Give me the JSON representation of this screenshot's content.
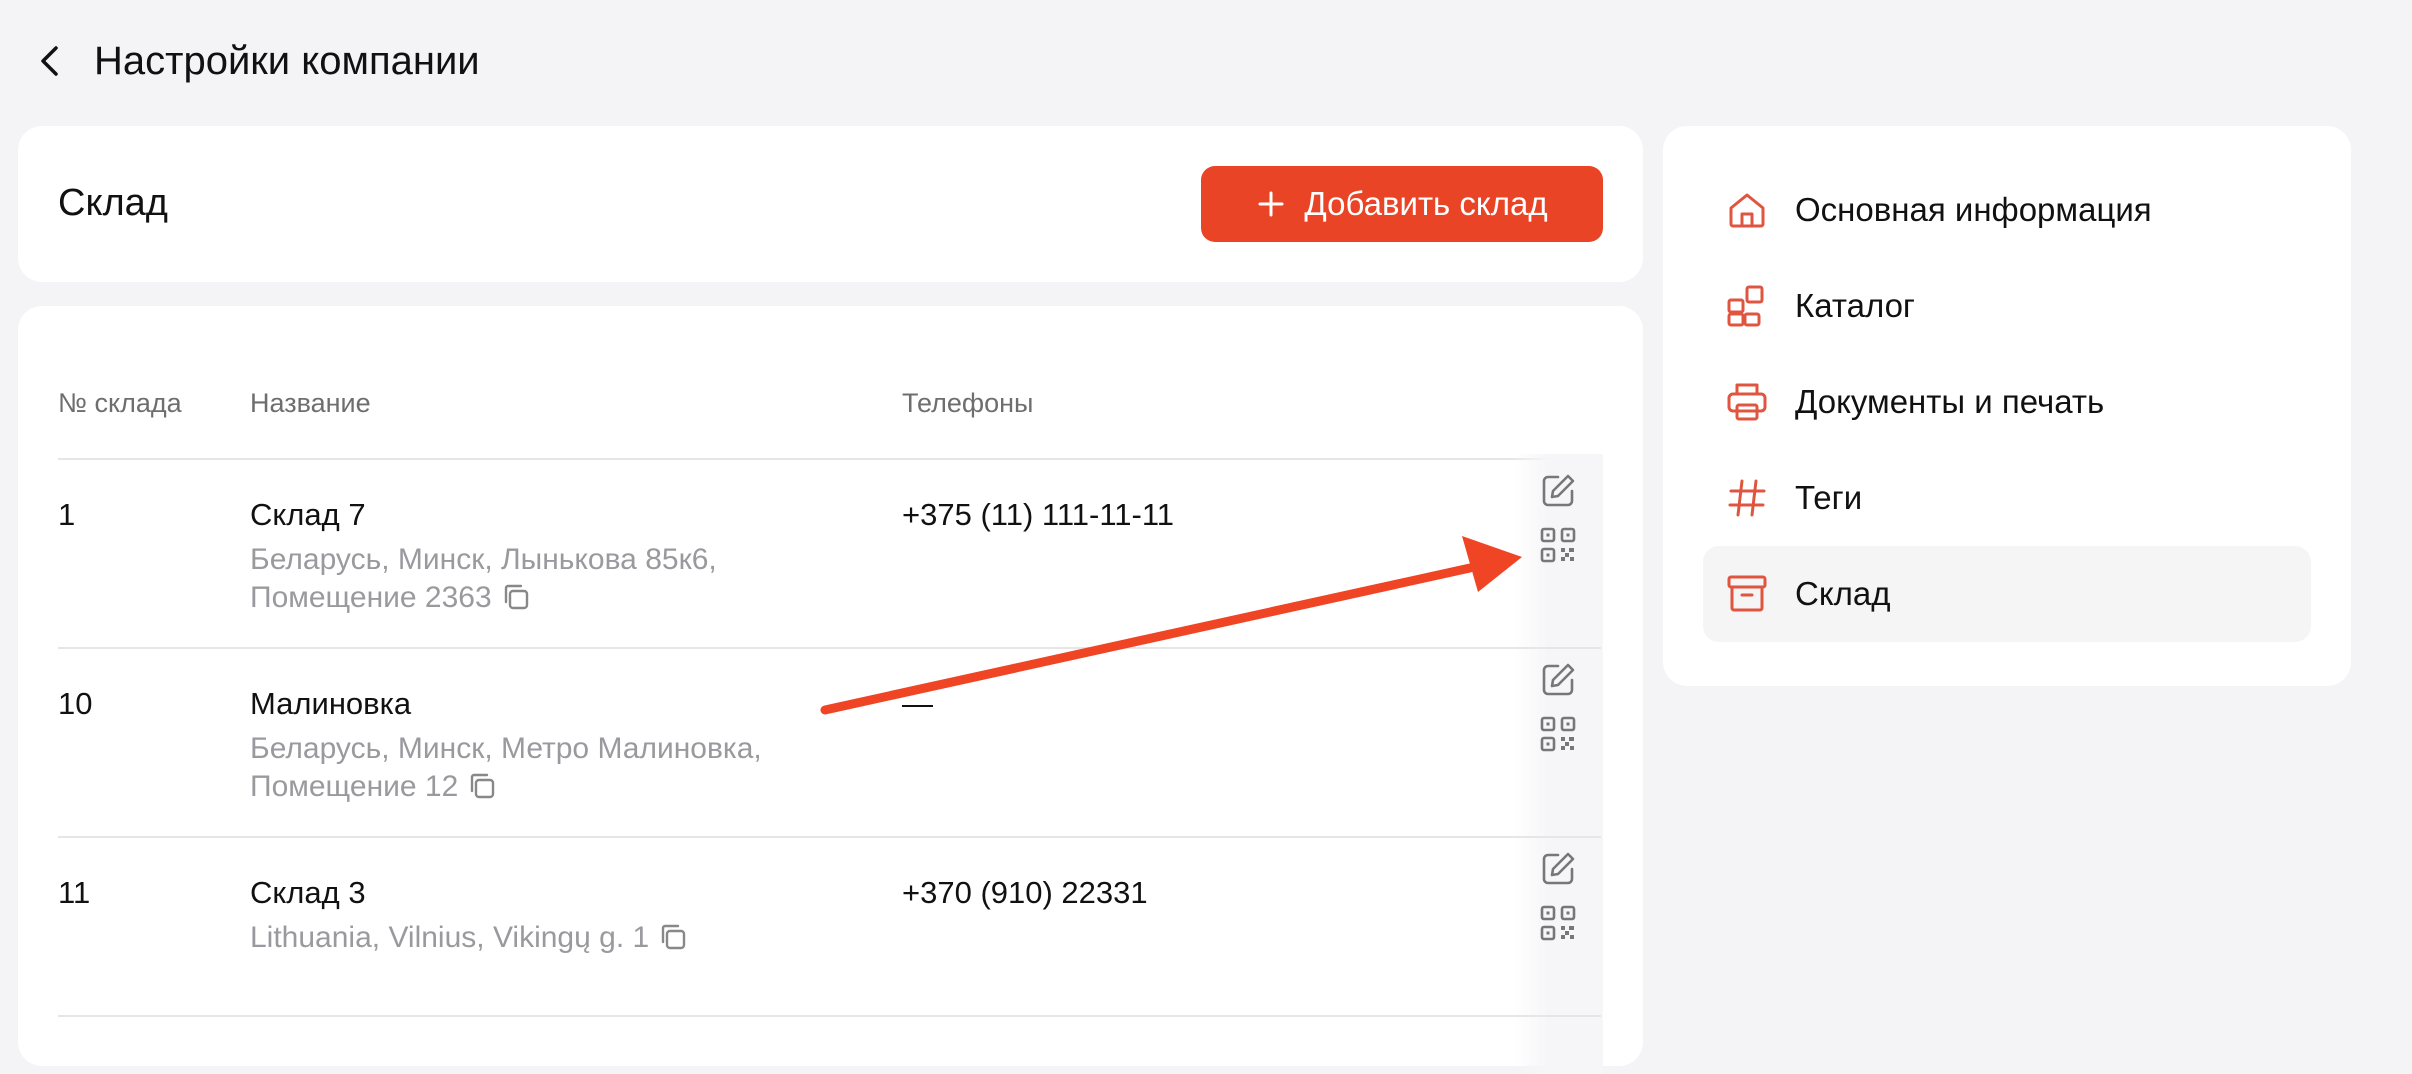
{
  "header": {
    "title": "Настройки компании"
  },
  "warehouse": {
    "title": "Склад",
    "add_label": "Добавить склад"
  },
  "table": {
    "columns": [
      "№ склада",
      "Название",
      "Телефоны"
    ],
    "rows": [
      {
        "num": "1",
        "name": "Склад 7",
        "address": "Беларусь, Минск, Лынькова 85к6, Помещение 2363",
        "phone": "+375 (11) 111-11-11"
      },
      {
        "num": "10",
        "name": "Малиновка",
        "address": "Беларусь, Минск, Метро Малиновка, Помещение 12",
        "phone": "—"
      },
      {
        "num": "11",
        "name": "Склад 3",
        "address": "Lithuania, Vilnius, Vikingų g. 1",
        "phone": "+370 (910) 22331"
      }
    ]
  },
  "nav": {
    "items": [
      {
        "label": "Основная информация",
        "icon": "home-icon"
      },
      {
        "label": "Каталог",
        "icon": "catalog-icon"
      },
      {
        "label": "Документы и печать",
        "icon": "printer-icon"
      },
      {
        "label": "Теги",
        "icon": "hash-icon"
      },
      {
        "label": "Склад",
        "icon": "archive-icon"
      }
    ],
    "active_index": 4
  },
  "colors": {
    "accent": "#ea4426",
    "icon_red": "#e0553f",
    "annotation_arrow": "#f04524"
  }
}
